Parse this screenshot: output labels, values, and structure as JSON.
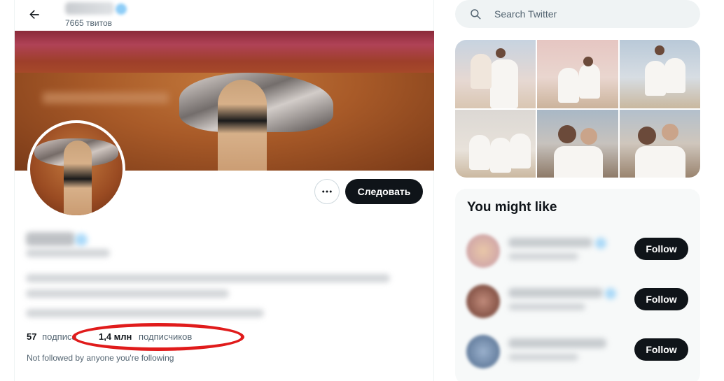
{
  "header": {
    "tweet_count": "7665 твитов"
  },
  "profile": {
    "follow_label": "Следовать",
    "following_count": "57",
    "following_label": "подписа",
    "followers_count": "1,4 млн",
    "followers_label": "подписчиков",
    "not_followed": "Not followed by anyone you're following"
  },
  "sidebar": {
    "search_placeholder": "Search Twitter",
    "might_like_title": "You might like",
    "suggestions": [
      {
        "follow_label": "Follow"
      },
      {
        "follow_label": "Follow"
      },
      {
        "follow_label": "Follow"
      }
    ]
  },
  "colors": {
    "primary_text": "#0f1419",
    "secondary_text": "#536471",
    "button_dark": "#0f1419",
    "highlight_red": "#e01b1b",
    "panel_bg": "#f7f9f9",
    "search_bg": "#eff3f4"
  },
  "icons": [
    "back-arrow-icon",
    "more-icon",
    "search-icon"
  ]
}
